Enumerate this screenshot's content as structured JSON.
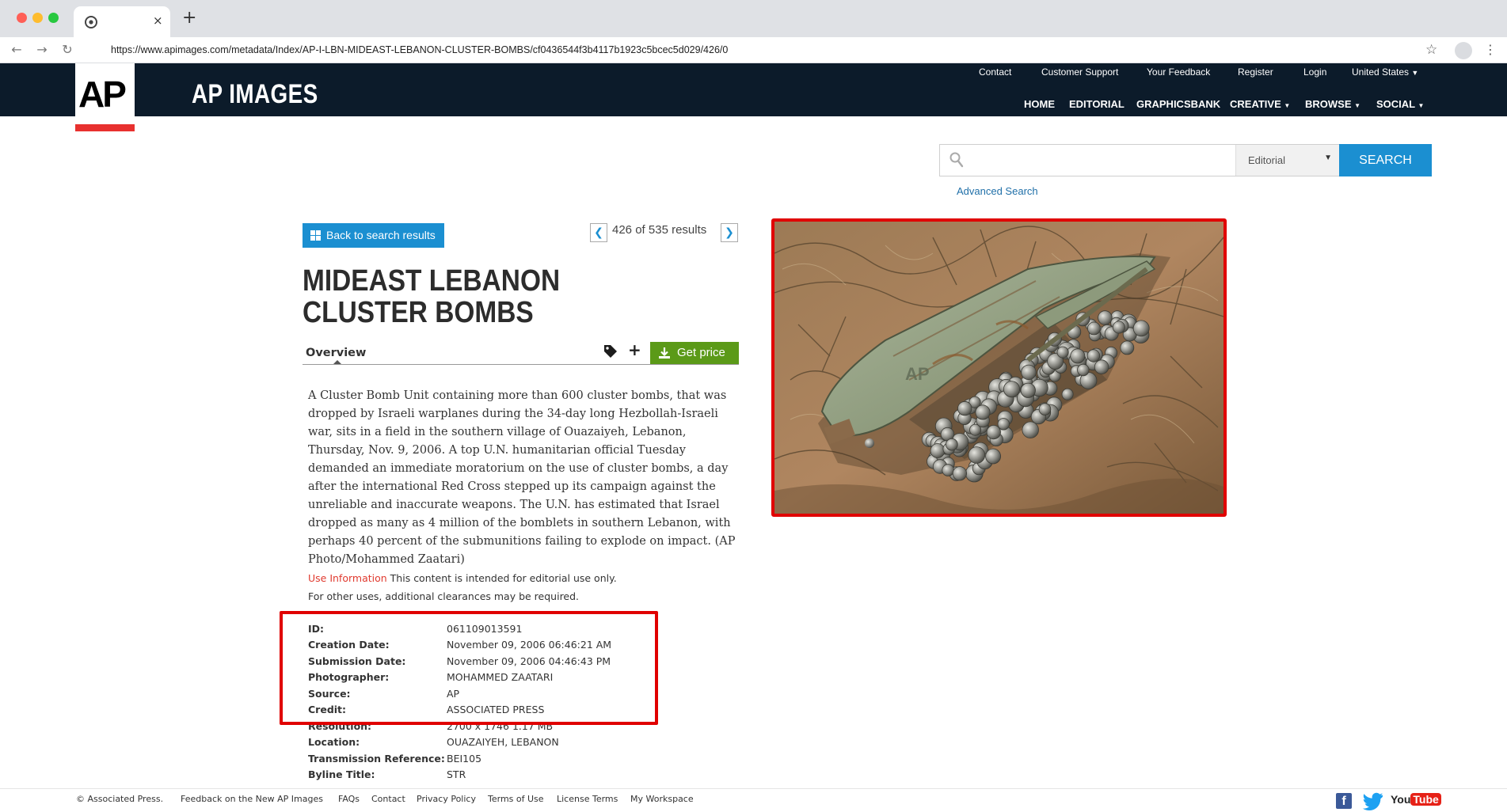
{
  "browser": {
    "url": "https://www.apimages.com/metadata/Index/AP-I-LBN-MIDEAST-LEBANON-CLUSTER-BOMBS/cf0436544f3b4117b1923c5bcec5d029/426/0",
    "tab_close": "×",
    "new_tab": "+"
  },
  "header": {
    "logo": "AP",
    "site_name": "AP IMAGES",
    "top_links": [
      "Contact",
      "Customer Support",
      "Your Feedback",
      "Register",
      "Login",
      "United States"
    ],
    "nav": [
      "HOME",
      "EDITORIAL",
      "GRAPHICSBANK",
      "CREATIVE",
      "BROWSE",
      "SOCIAL"
    ]
  },
  "search": {
    "placeholder": "",
    "collection": "Editorial",
    "button": "SEARCH",
    "advanced": "Advanced Search"
  },
  "result_nav": {
    "back_label": "Back to search results",
    "current": "426",
    "of_word": "of",
    "total": "535",
    "results_word": "results"
  },
  "asset": {
    "title": "MIDEAST LEBANON CLUSTER BOMBS",
    "tab_overview": "Overview",
    "get_price": "Get price",
    "caption": "A Cluster Bomb Unit containing more than 600 cluster bombs, that was dropped by Israeli warplanes during the 34-day long Hezbollah-Israeli war, sits in a field in the southern village of Ouazaiyeh, Lebanon, Thursday, Nov. 9, 2006. A top U.N. humanitarian official Tuesday demanded an immediate moratorium on the use of cluster bombs, a day after the international Red Cross stepped up its campaign against the unreliable and inaccurate weapons. The U.N. has estimated that Israel dropped as many as 4 million of the bomblets in southern Lebanon, with perhaps 40 percent of the submunitions failing to explode on impact. (AP Photo/Mohammed Zaatari)",
    "use_info_link": "Use Information",
    "use_info_text": "This content is intended for editorial use only.",
    "use_info_text2": "For other uses, additional clearances may be required.",
    "photo_watermark": "AP",
    "metadata": [
      {
        "label": "ID:",
        "value": "061109013591"
      },
      {
        "label": "Creation Date:",
        "value": "November 09, 2006 06:46:21 AM"
      },
      {
        "label": "Submission Date:",
        "value": "November 09, 2006 04:46:43 PM"
      },
      {
        "label": "Photographer:",
        "value": "MOHAMMED ZAATARI"
      },
      {
        "label": "Source:",
        "value": "AP"
      },
      {
        "label": "Credit:",
        "value": "ASSOCIATED PRESS"
      },
      {
        "label": "Resolution:",
        "value": "2700 x 1746 1.17 MB"
      },
      {
        "label": "Location:",
        "value": "OUAZAIYEH, LEBANON"
      },
      {
        "label": "Transmission Reference:",
        "value": "BEI105"
      },
      {
        "label": "Byline Title:",
        "value": "STR"
      }
    ]
  },
  "footer": {
    "links": [
      "© Associated Press.",
      "Feedback on the New AP Images",
      "FAQs",
      "Contact",
      "Privacy Policy",
      "Terms of Use",
      "License Terms",
      "My Workspace"
    ],
    "facebook": "f",
    "youtube_you": "You",
    "youtube_tube": "Tube"
  },
  "colors": {
    "header_bg": "#0c1b2a",
    "accent_blue": "#1b8fd1",
    "price_green": "#5b9a18",
    "logo_red": "#e8312f",
    "highlight_red": "#e00000"
  }
}
